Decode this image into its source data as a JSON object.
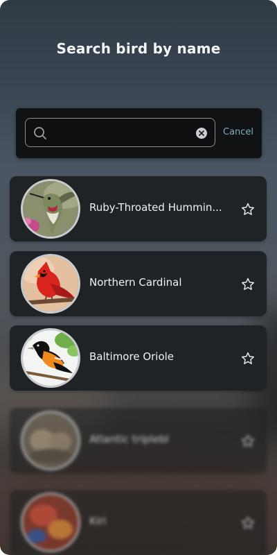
{
  "header": {
    "title": "Search bird by name"
  },
  "search": {
    "value": "",
    "placeholder": "",
    "cancel_label": "Cancel"
  },
  "birds": [
    {
      "name": "Ruby-Throated Hummin...",
      "favorite": false,
      "image": "hummingbird"
    },
    {
      "name": "Northern Cardinal",
      "favorite": false,
      "image": "cardinal"
    },
    {
      "name": "Baltimore Oriole",
      "favorite": false,
      "image": "oriole"
    },
    {
      "name": "Atlantic triplebl",
      "favorite": false,
      "image": "owl-chicks"
    },
    {
      "name": "Kiri",
      "favorite": false,
      "image": "colorful-bird"
    }
  ],
  "icons": {
    "search": "search-icon",
    "clear": "clear-icon",
    "favorite": "star-outline-icon"
  },
  "colors": {
    "accent": "#7fb0b9",
    "card": "#1f2326",
    "panel": "#101214",
    "text": "#f0f2f4"
  }
}
